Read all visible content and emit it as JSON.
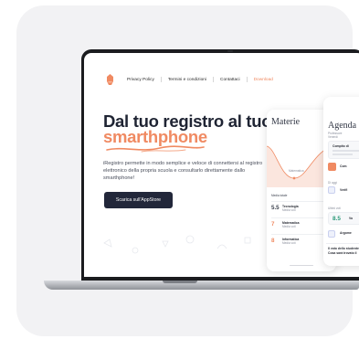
{
  "nav": {
    "links": [
      {
        "label": "Privacy Policy"
      },
      {
        "label": "Termini e condizioni"
      },
      {
        "label": "Contattaci"
      },
      {
        "label": "Download"
      }
    ]
  },
  "hero": {
    "title_line1": "Dal tuo registro al tuo",
    "title_line2": "smarthphone",
    "subtitle": "iRegistro permette in modo semplice e veloce di connettersi al registro elettronico della propria scuola e consultarlo direttamente dallo smarthphone!",
    "cta_label": "Scarica sull'AppStore"
  },
  "phone_left": {
    "title": "Materie",
    "section_label": "Media totale",
    "chart_label": "Matematica",
    "rows": [
      {
        "grade": "5.5",
        "name": "Tecnologia",
        "sub": "Media voti"
      },
      {
        "grade": "7",
        "name": "Matematica",
        "sub": "Media voti"
      },
      {
        "grade": "8",
        "name": "Informatica",
        "sub": "Media voti"
      }
    ]
  },
  "phone_right": {
    "title": "Agenda",
    "sub1": "Professore",
    "sub2": "Venerdì",
    "item1": "Compito di",
    "item2": "Com",
    "today_label": "Di oggi",
    "item3": "Verifi",
    "grades_label": "Ultimi voti",
    "grade_value": "8.5",
    "grade_text": "Vo",
    "item4": "Argome",
    "footer1": "Il voto dello studente",
    "footer2": "Cosa sarà trovato il"
  },
  "colors": {
    "accent": "#f08a62",
    "dark": "#1f2433",
    "button": "#22273a"
  }
}
